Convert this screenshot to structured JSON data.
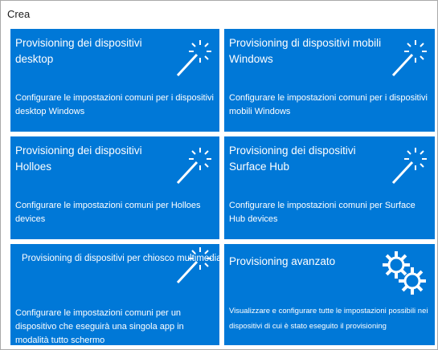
{
  "section": {
    "title": "Crea"
  },
  "tiles": [
    {
      "title": "Provisioning dei dispositivi desktop",
      "description": "Configurare le impostazioni comuni per i dispositivi desktop Windows",
      "icon": "magic-wand-icon"
    },
    {
      "title": "Provisioning di dispositivi mobili Windows",
      "description": "Configurare le impostazioni comuni per i dispositivi mobili Windows",
      "icon": "magic-wand-icon"
    },
    {
      "title": "Provisioning dei dispositivi Holloes",
      "description": "Configurare le impostazioni comuni per Holloes devices",
      "icon": "magic-wand-icon"
    },
    {
      "title": "Provisioning dei dispositivi Surface Hub",
      "description": "Configurare le impostazioni comuni per Surface Hub devices",
      "icon": "magic-wand-icon"
    },
    {
      "title": "Provisioning di dispositivi per chiosco multimediale",
      "description": "Configurare le impostazioni comuni per un dispositivo che eseguirà una singola app in modalità tutto schermo",
      "icon": "magic-wand-icon"
    },
    {
      "title": "Provisioning avanzato",
      "description": "Visualizzare e configurare tutte le impostazioni possibili nei dispositivi di cui è stato eseguito il provisioning",
      "icon": "gears-icon"
    }
  ],
  "colors": {
    "tile_background": "#0078d7",
    "tile_text": "#ffffff",
    "border": "#a9a9a9"
  }
}
